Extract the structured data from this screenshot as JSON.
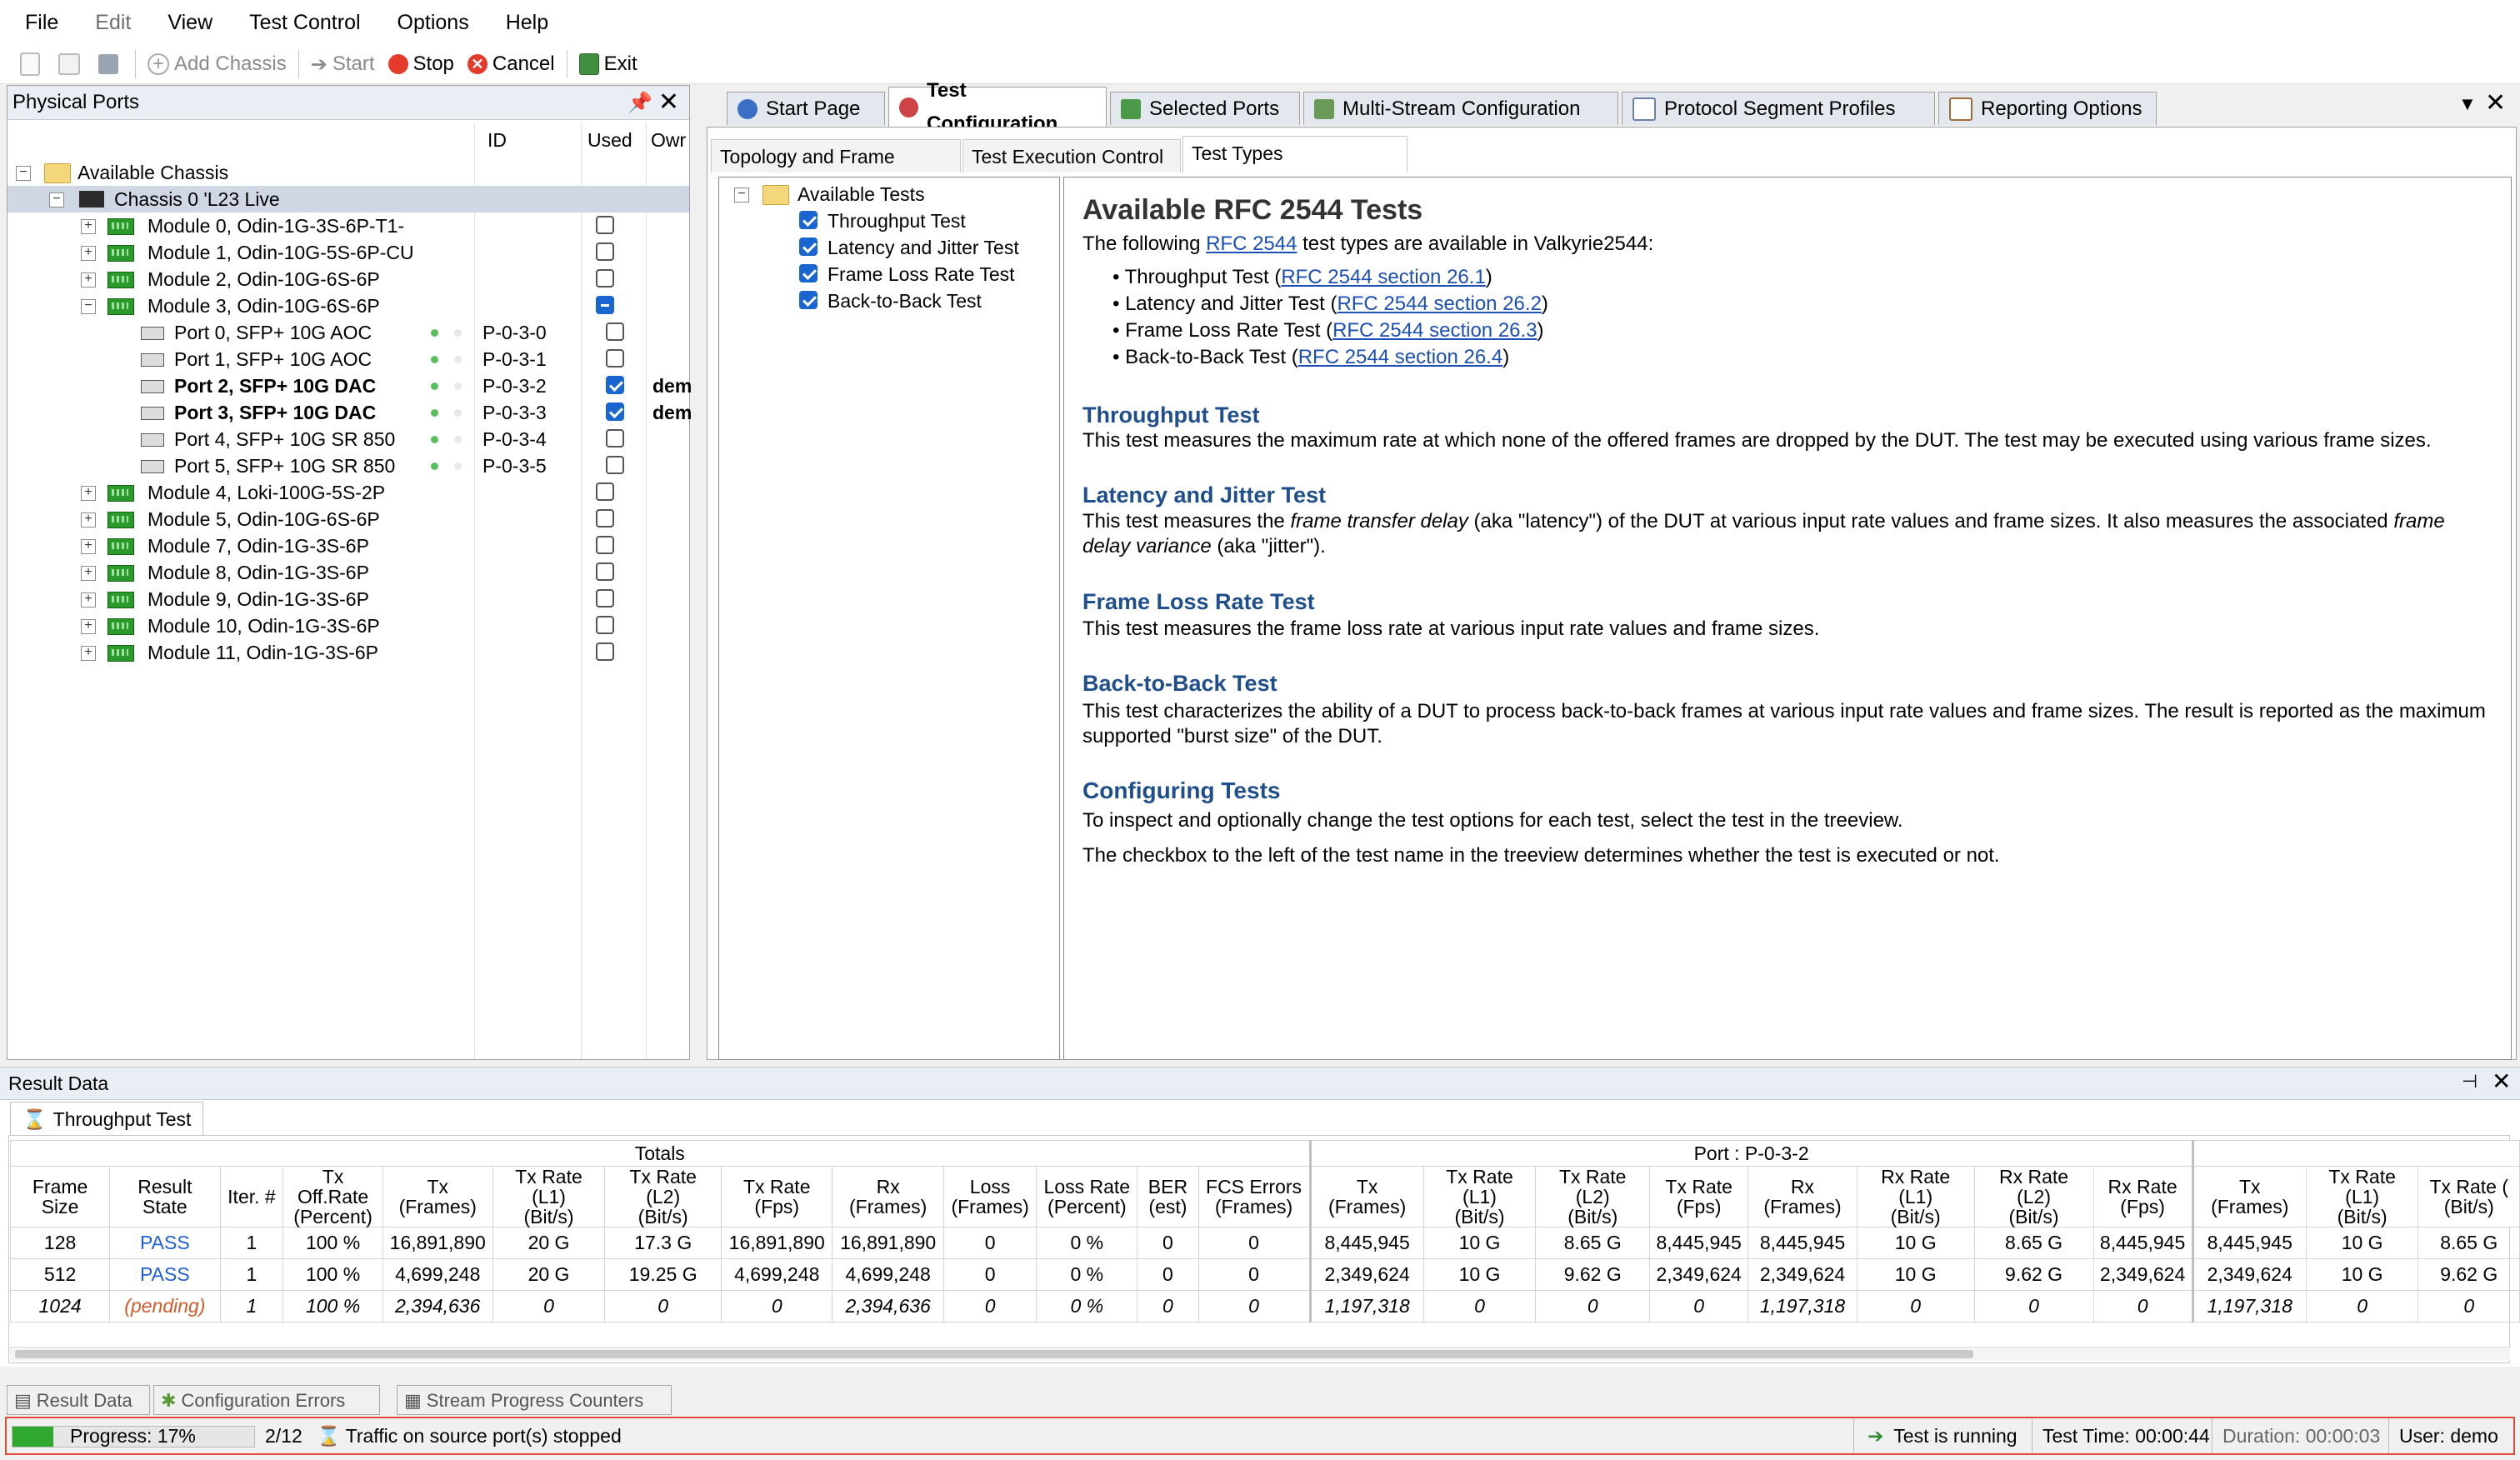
{
  "menu": [
    "File",
    "Edit",
    "View",
    "Test Control",
    "Options",
    "Help"
  ],
  "toolbar": {
    "add_chassis": "Add Chassis",
    "start": "Start",
    "stop": "Stop",
    "cancel": "Cancel",
    "exit": "Exit"
  },
  "physical_ports": {
    "title": "Physical Ports",
    "columns": {
      "id": "ID",
      "used": "Used",
      "owner": "Owr"
    },
    "root": "Available Chassis",
    "chassis": "Chassis 0 'L23 Live",
    "modules_top": [
      "Module 0, Odin-1G-3S-6P-T1-",
      "Module 1, Odin-10G-5S-6P-CU",
      "Module 2, Odin-10G-6S-6P",
      "Module 3, Odin-10G-6S-6P"
    ],
    "ports": [
      {
        "name": "Port 0, SFP+ 10G AOC",
        "id": "P-0-3-0",
        "used": false,
        "owner": ""
      },
      {
        "name": "Port 1, SFP+ 10G AOC",
        "id": "P-0-3-1",
        "used": false,
        "owner": ""
      },
      {
        "name": "Port 2, SFP+ 10G DAC",
        "id": "P-0-3-2",
        "used": true,
        "owner": "dem"
      },
      {
        "name": "Port 3, SFP+ 10G DAC",
        "id": "P-0-3-3",
        "used": true,
        "owner": "dem"
      },
      {
        "name": "Port 4, SFP+ 10G SR 850",
        "id": "P-0-3-4",
        "used": false,
        "owner": ""
      },
      {
        "name": "Port 5, SFP+ 10G SR 850",
        "id": "P-0-3-5",
        "used": false,
        "owner": ""
      }
    ],
    "modules_bottom": [
      "Module 4, Loki-100G-5S-2P",
      "Module 5, Odin-10G-6S-6P",
      "Module 7, Odin-1G-3S-6P",
      "Module 8, Odin-1G-3S-6P",
      "Module 9, Odin-1G-3S-6P",
      "Module 10, Odin-1G-3S-6P",
      "Module 11, Odin-1G-3S-6P"
    ]
  },
  "tabs": [
    "Start Page",
    "Test Configuration",
    "Selected Ports",
    "Multi-Stream Configuration",
    "Protocol Segment Profiles",
    "Reporting Options"
  ],
  "subtabs": [
    "Topology and Frame Content",
    "Test Execution Control",
    "Test Types Configuration"
  ],
  "tests_tree": {
    "root": "Available Tests",
    "items": [
      "Throughput Test",
      "Latency and Jitter Test",
      "Frame Loss Rate Test",
      "Back-to-Back Test"
    ]
  },
  "content": {
    "title": "Available RFC 2544 Tests",
    "intro_a": "The following ",
    "intro_link": "RFC 2544",
    "intro_b": " test types are available in Valkyrie2544:",
    "bullets": [
      {
        "name": "Throughput Test (",
        "link": "RFC 2544 section 26.1",
        "end": ")"
      },
      {
        "name": "Latency and Jitter Test (",
        "link": "RFC 2544 section 26.2",
        "end": ")"
      },
      {
        "name": "Frame Loss Rate Test (",
        "link": "RFC 2544 section 26.3",
        "end": ")"
      },
      {
        "name": "Back-to-Back Test (",
        "link": "RFC 2544 section 26.4",
        "end": ")"
      }
    ],
    "throughput_h": "Throughput Test",
    "throughput_p": "This test measures the maximum rate at which none of the offered frames are dropped by the DUT. The test may be executed using various frame sizes.",
    "latency_h": "Latency and Jitter Test",
    "latency_p1": "This test measures the ",
    "latency_em1": "frame transfer delay",
    "latency_p2": " (aka \"latency\") of the DUT at various input rate values and frame sizes. It also measures the associated ",
    "latency_em2": "frame delay variance",
    "latency_p3": " (aka \"jitter\").",
    "loss_h": "Frame Loss Rate Test",
    "loss_p": "This test measures the frame loss rate at various input rate values and frame sizes.",
    "b2b_h": "Back-to-Back Test",
    "b2b_p": "This test characterizes the ability of a DUT to process back-to-back frames at various input rate values and frame sizes. The result is reported as the maximum supported \"burst size\" of the DUT.",
    "config_h": "Configuring Tests",
    "config_p1": "To inspect and optionally change the test options for each test, select the test in the treeview.",
    "config_p2": "The checkbox to the left of the test name in the treeview determines whether the test is executed or not."
  },
  "result_data": {
    "title": "Result Data",
    "tab": "Throughput Test",
    "group_totals": "Totals",
    "group_port": "Port : P-0-3-2",
    "headers": [
      "Frame Size",
      "Result State",
      "Iter. #",
      "Tx Off.Rate\n(Percent)",
      "Tx\n(Frames)",
      "Tx Rate (L1)\n(Bit/s)",
      "Tx Rate (L2)\n(Bit/s)",
      "Tx Rate\n(Fps)",
      "Rx\n(Frames)",
      "Loss\n(Frames)",
      "Loss Rate\n(Percent)",
      "BER\n(est)",
      "FCS Errors\n(Frames)",
      "Tx\n(Frames)",
      "Tx Rate (L1)\n(Bit/s)",
      "Tx Rate (L2)\n(Bit/s)",
      "Tx Rate\n(Fps)",
      "Rx\n(Frames)",
      "Rx Rate (L1)\n(Bit/s)",
      "Rx Rate (L2)\n(Bit/s)",
      "Rx Rate\n(Fps)",
      "Tx\n(Frames)",
      "Tx Rate (L1)\n(Bit/s)",
      "Tx Rate (\n(Bit/s)"
    ],
    "rows": [
      [
        "128",
        "PASS",
        "1",
        "100 %",
        "16,891,890",
        "20 G",
        "17.3 G",
        "16,891,890",
        "16,891,890",
        "0",
        "0 %",
        "0",
        "0",
        "8,445,945",
        "10 G",
        "8.65 G",
        "8,445,945",
        "8,445,945",
        "10 G",
        "8.65 G",
        "8,445,945",
        "8,445,945",
        "10 G",
        "8.65 G"
      ],
      [
        "512",
        "PASS",
        "1",
        "100 %",
        "4,699,248",
        "20 G",
        "19.25 G",
        "4,699,248",
        "4,699,248",
        "0",
        "0 %",
        "0",
        "0",
        "2,349,624",
        "10 G",
        "9.62 G",
        "2,349,624",
        "2,349,624",
        "10 G",
        "9.62 G",
        "2,349,624",
        "2,349,624",
        "10 G",
        "9.62 G"
      ],
      [
        "1024",
        "(pending)",
        "1",
        "100 %",
        "2,394,636",
        "0",
        "0",
        "0",
        "2,394,636",
        "0",
        "0 %",
        "0",
        "0",
        "1,197,318",
        "0",
        "0",
        "0",
        "1,197,318",
        "0",
        "0",
        "0",
        "1,197,318",
        "0",
        "0"
      ]
    ]
  },
  "bottom_tabs": [
    "Result Data",
    "Configuration Errors",
    "Stream Progress Counters"
  ],
  "status": {
    "progress_label": "Progress: 17%",
    "progress_value": 17,
    "iteration": "2/12",
    "message": "Traffic on source port(s) stopped",
    "running": "Test is running",
    "test_time": "Test Time: 00:00:44",
    "duration": "Duration: 00:00:03",
    "user": "User: demo"
  }
}
